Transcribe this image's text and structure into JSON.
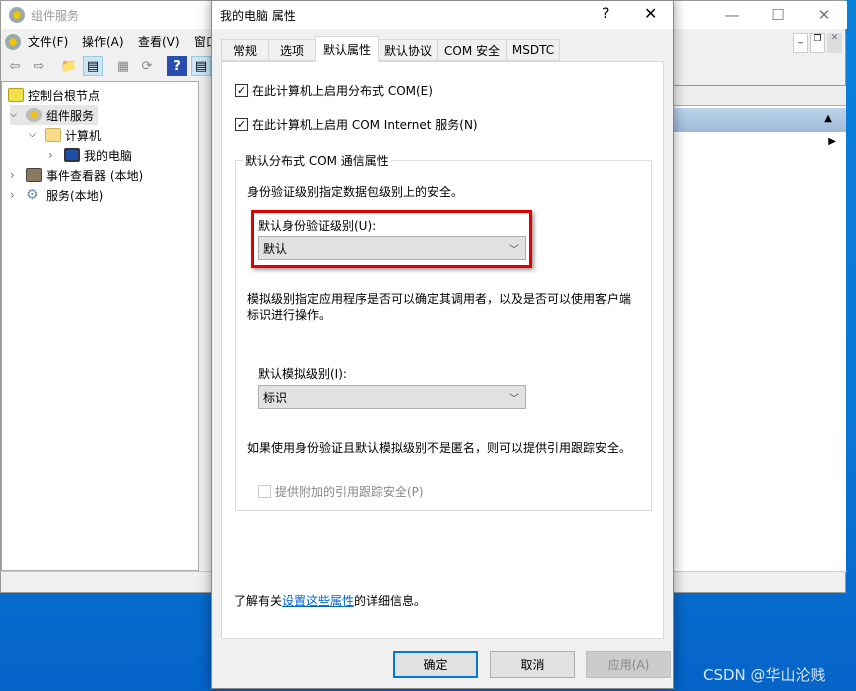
{
  "main_window": {
    "title": "组件服务",
    "menu": [
      "文件(F)",
      "操作(A)",
      "查看(V)",
      "窗口"
    ],
    "tree": [
      {
        "label": "控制台根节点",
        "icon": "folder-icon"
      },
      {
        "label": "组件服务",
        "icon": "component-services-icon"
      },
      {
        "label": "计算机",
        "icon": "folder-icon"
      },
      {
        "label": "我的电脑",
        "icon": "computer-icon"
      },
      {
        "label": "事件查看器 (本地)",
        "icon": "event-viewer-icon"
      },
      {
        "label": "服务(本地)",
        "icon": "gear-icon"
      }
    ]
  },
  "dialog": {
    "title": "我的电脑 属性",
    "help": "?",
    "tabs": [
      "常规",
      "选项",
      "默认属性",
      "默认协议",
      "COM 安全",
      "MSDTC"
    ],
    "active_tab": "默认属性",
    "enable_dcom": {
      "label": "在此计算机上启用分布式 COM(E)",
      "checked": true
    },
    "enable_internet": {
      "label": "在此计算机上启用 COM Internet 服务(N)",
      "checked": true
    },
    "group_title": "默认分布式 COM 通信属性",
    "auth_desc": "身份验证级别指定数据包级别上的安全。",
    "auth_label": "默认身份验证级别(U):",
    "auth_value": "默认",
    "imp_desc": "模拟级别指定应用程序是否可以确定其调用者，以及是否可以使用客户端标识进行操作。",
    "imp_label": "默认模拟级别(I):",
    "imp_value": "标识",
    "tracking_desc": "如果使用身份验证且默认模拟级别不是匿名，则可以提供引用跟踪安全。",
    "tracking": {
      "label": "提供附加的引用跟踪安全(P)",
      "checked": false,
      "enabled": false
    },
    "info_prefix": "了解有关",
    "info_link": "设置这些属性",
    "info_suffix": "的详细信息。",
    "ok": "确定",
    "cancel": "取消",
    "apply": "应用(A)",
    "highlight_color": "#e00000"
  },
  "watermark": "CSDN @华山沦贱"
}
